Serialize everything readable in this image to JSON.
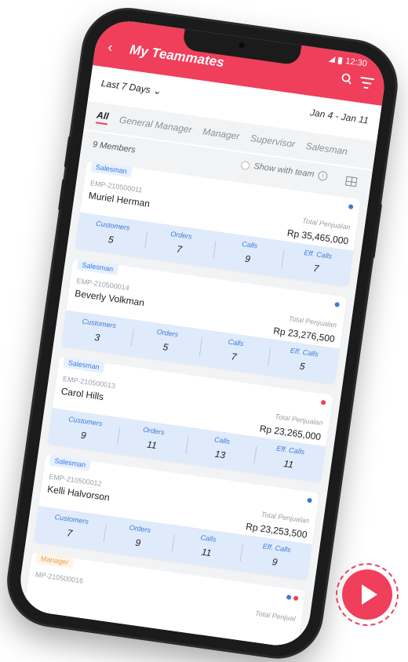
{
  "status": {
    "time": "12:30"
  },
  "appbar": {
    "title": "My Teammates"
  },
  "filter": {
    "range": "Last 7 Days",
    "dates": "Jan 4 - Jan 11"
  },
  "tabs": [
    "All",
    "General Manager",
    "Manager",
    "Supervisor",
    "Salesman"
  ],
  "list": {
    "count": "9 Members",
    "show_with_team": "Show with team"
  },
  "stat_labels": {
    "customers": "Customers",
    "orders": "Orders",
    "calls": "Calls",
    "eff_calls": "Eff. Calls"
  },
  "total_label": "Total Penjualan",
  "cards": [
    {
      "role": "Salesman",
      "emp": "EMP-210500011",
      "name": "Muriel Herman",
      "total": "Rp 35,465,000",
      "customers": "5",
      "orders": "7",
      "calls": "9",
      "eff_calls": "7",
      "dots": [
        "#3b7ad9"
      ]
    },
    {
      "role": "Salesman",
      "emp": "EMP-210500014",
      "name": "Beverly Volkman",
      "total": "Rp 23,276,500",
      "customers": "3",
      "orders": "5",
      "calls": "7",
      "eff_calls": "5",
      "dots": [
        "#3b7ad9"
      ]
    },
    {
      "role": "Salesman",
      "emp": "EMP-210500013",
      "name": "Carol Hills",
      "total": "Rp 23,265,000",
      "customers": "9",
      "orders": "11",
      "calls": "13",
      "eff_calls": "11",
      "dots": [
        "#ef3f5a"
      ]
    },
    {
      "role": "Salesman",
      "emp": "EMP-210500012",
      "name": "Kelli Halvorson",
      "total": "Rp 23,253,500",
      "customers": "7",
      "orders": "9",
      "calls": "11",
      "eff_calls": "9",
      "dots": [
        "#3b7ad9"
      ]
    },
    {
      "role": "Manager",
      "emp": "MP-210500016",
      "name": "",
      "total": "",
      "customers": "",
      "orders": "",
      "calls": "",
      "eff_calls": "",
      "dots": [
        "#3b7ad9",
        "#ef3f5a"
      ]
    }
  ],
  "colors": {
    "accent": "#ef3f5a",
    "blue": "#3b7ad9"
  }
}
